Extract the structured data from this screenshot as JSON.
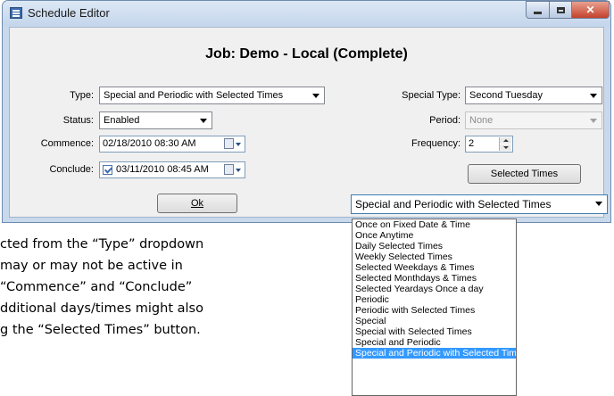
{
  "window": {
    "title": "Schedule Editor"
  },
  "heading": "Job: Demo - Local (Complete)",
  "left": {
    "type_label": "Type:",
    "type_value": "Special and Periodic with Selected Times",
    "status_label": "Status:",
    "status_value": "Enabled",
    "commence_label": "Commence:",
    "commence_value": "02/18/2010  08:30 AM",
    "conclude_label": "Conclude:",
    "conclude_value": "03/11/2010  08:45 AM",
    "conclude_checked": true,
    "ok_label": "Ok"
  },
  "right": {
    "special_type_label": "Special Type:",
    "special_type_value": "Second Tuesday",
    "period_label": "Period:",
    "period_value": "None",
    "frequency_label": "Frequency:",
    "frequency_value": "2",
    "selected_times_label": "Selected Times"
  },
  "dropdown": {
    "value": "Special and Periodic with Selected Times",
    "options": [
      "Once on Fixed Date & Time",
      "Once Anytime",
      "Daily Selected Times",
      "Weekly Selected Times",
      "Selected Weekdays & Times",
      "Selected Monthdays & Times",
      "Selected Yeardays Once a day",
      "Periodic",
      "Periodic with Selected Times",
      "Special",
      "Special with Selected Times",
      "Special and Periodic",
      "Special and Periodic with Selected Times"
    ],
    "selected_index": 12
  },
  "body_lines": [
    "cted from the “Type” dropdown",
    "may or may not be active in",
    " “Commence” and “Conclude”",
    "dditional days/times might also",
    "g the “Selected Times” button."
  ],
  "colors": {
    "selection": "#3399ff",
    "window_frame": "#c9d9ec",
    "close_button": "#c5412b"
  }
}
